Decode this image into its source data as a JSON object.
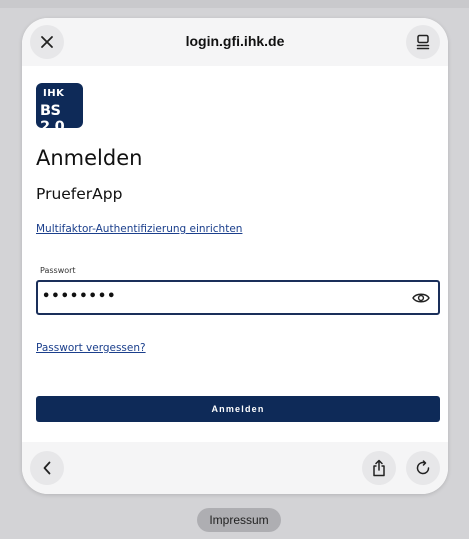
{
  "browser": {
    "url": "login.gfi.ihk.de",
    "icons": {
      "close": "close-icon",
      "tabs": "tabs-icon",
      "back": "chevron-left-icon",
      "share": "share-icon",
      "reload": "reload-icon"
    }
  },
  "logo": {
    "line1": "IHK",
    "line2": "BS 2.0"
  },
  "page": {
    "title": "Anmelden",
    "subtitle": "PrueferApp",
    "mfa_link": "Multifaktor-Authentifizierung einrichten",
    "password_label": "Passwort",
    "password_value": "••••••••",
    "forgot_link": "Passwort vergessen?",
    "submit_label": "Anmelden"
  },
  "footer": {
    "impressum": "Impressum"
  },
  "colors": {
    "brand": "#0e2a58",
    "link": "#1b3f8c"
  }
}
